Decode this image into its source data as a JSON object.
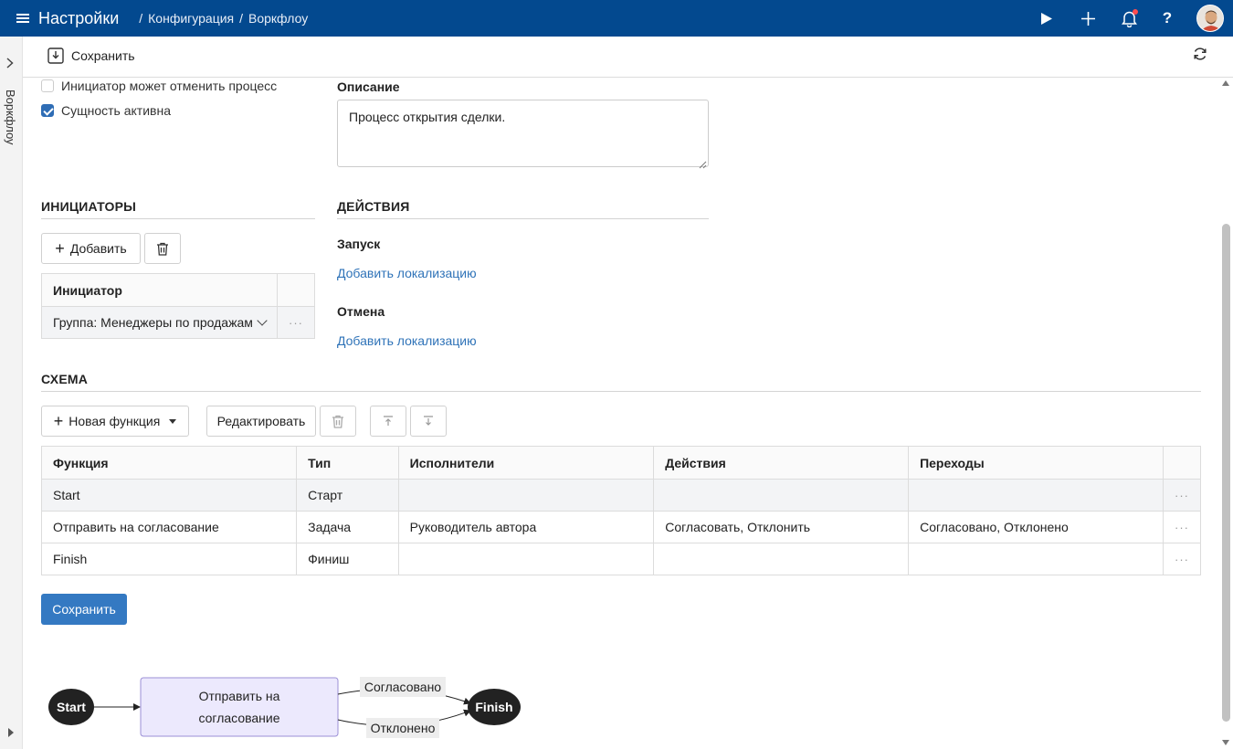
{
  "header": {
    "app_title": "Настройки",
    "breadcrumb": [
      "Конфигурация",
      "Воркфлоу"
    ],
    "icons": [
      "menu-icon",
      "play-icon",
      "plus-icon",
      "bell-icon",
      "help-icon",
      "avatar"
    ],
    "help_label": "?"
  },
  "left_panel": {
    "label": "Воркфлоу"
  },
  "toolbar": {
    "save_label": "Сохранить"
  },
  "options": {
    "can_cancel_label": "Инициатор может отменить процесс",
    "can_cancel_checked": false,
    "active_label": "Сущность активна",
    "active_checked": true
  },
  "description": {
    "label": "Описание",
    "value": "Процесс открытия сделки."
  },
  "initiators": {
    "title": "ИНИЦИАТОРЫ",
    "add_label": "Добавить",
    "column": "Инициатор",
    "rows": [
      {
        "value": "Группа: Менеджеры по продажам",
        "more": "···"
      }
    ]
  },
  "actions": {
    "title": "ДЕЙСТВИЯ",
    "start_label": "Запуск",
    "start_link": "Добавить локализацию",
    "cancel_label": "Отмена",
    "cancel_link": "Добавить локализацию"
  },
  "schema": {
    "title": "СХЕМА",
    "new_function_label": "Новая функция",
    "edit_label": "Редактировать",
    "columns": [
      "Функция",
      "Тип",
      "Исполнители",
      "Действия",
      "Переходы"
    ],
    "rows": [
      {
        "function": "Start",
        "type": "Старт",
        "executors": "",
        "actions": "",
        "transitions": "",
        "more": "···"
      },
      {
        "function": "Отправить на согласование",
        "type": "Задача",
        "executors": "Руководитель автора",
        "actions": "Согласовать, Отклонить",
        "transitions": "Согласовано, Отклонено",
        "more": "···"
      },
      {
        "function": "Finish",
        "type": "Финиш",
        "executors": "",
        "actions": "",
        "transitions": "",
        "more": "···"
      }
    ]
  },
  "footer": {
    "save_label": "Сохранить"
  },
  "diagram": {
    "start_label": "Start",
    "task_line1": "Отправить на",
    "task_line2": "согласование",
    "finish_label": "Finish",
    "edge_approved": "Согласовано",
    "edge_rejected": "Отклонено"
  }
}
